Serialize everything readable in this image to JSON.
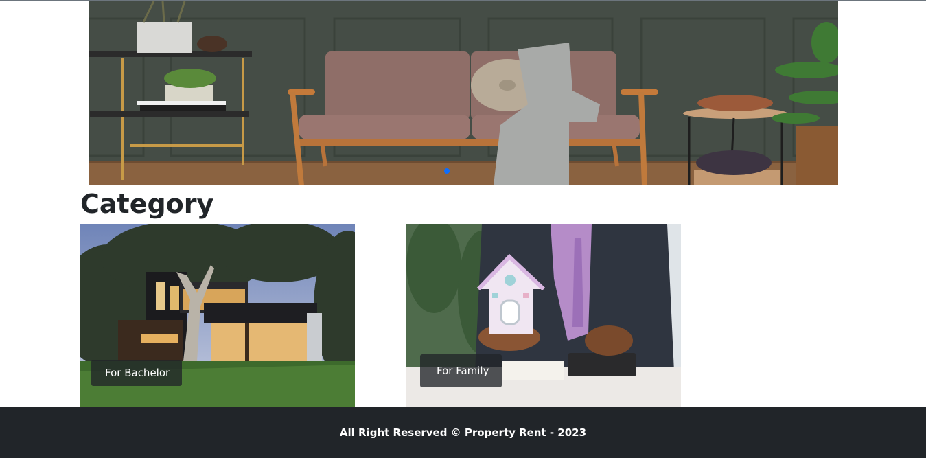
{
  "hero": {
    "active_slide": 1
  },
  "category": {
    "title": "Category",
    "cards": [
      {
        "label": "For Bachelor"
      },
      {
        "label": "For Family"
      }
    ]
  },
  "footer": {
    "text": "All Right Reserved © Property Rent - 2023"
  },
  "colors": {
    "footer_bg": "#212529",
    "carousel_indicator": "#0d6efd",
    "wall": "#434b44"
  }
}
